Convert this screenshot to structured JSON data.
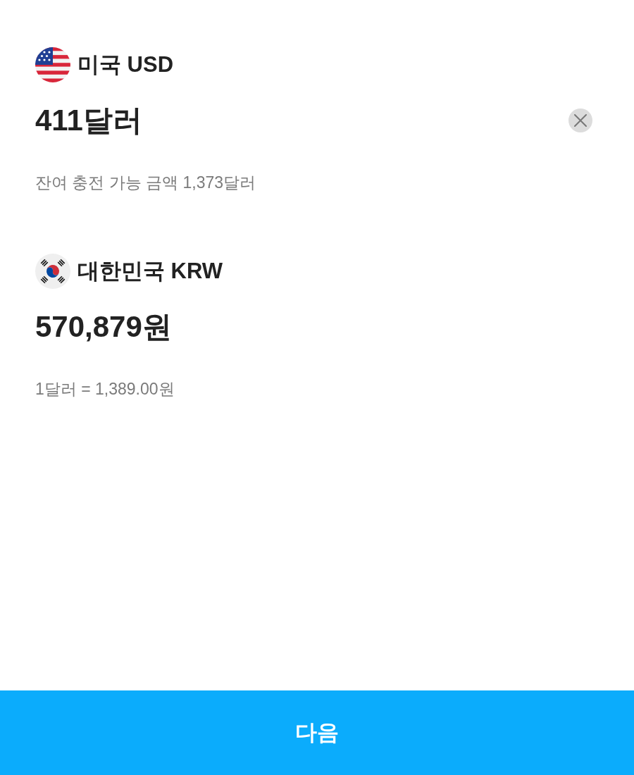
{
  "sections": [
    {
      "currency": "미국 USD",
      "amount": "411달러",
      "clearable": true,
      "note": "잔여 충전 가능 금액 1,373달러"
    },
    {
      "currency": "대한민국 KRW",
      "amount": "570,879원",
      "clearable": false,
      "note": "1달러 = 1,389.00원"
    }
  ],
  "next_button": {
    "label": "다음"
  }
}
